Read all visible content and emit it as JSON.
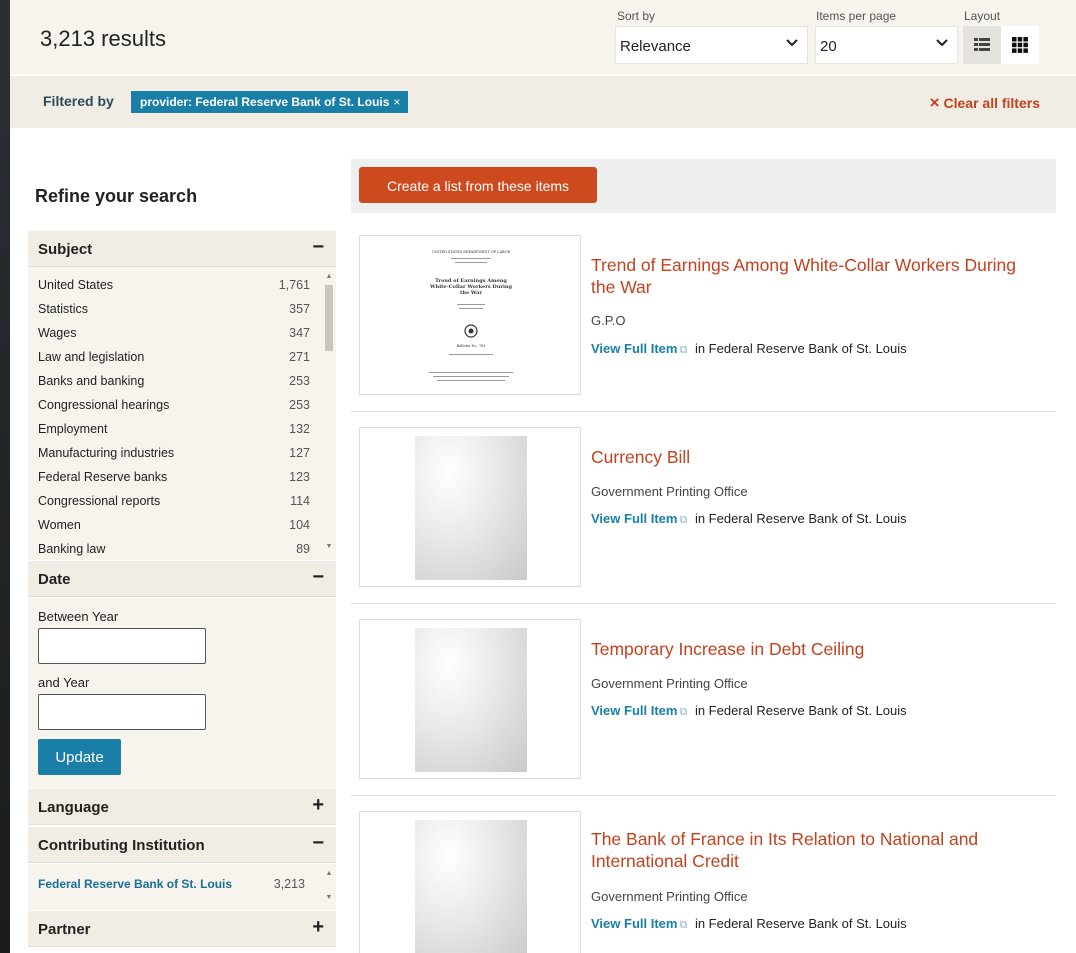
{
  "header": {
    "results_count": "3,213 results",
    "sort_label": "Sort by",
    "sort_value": "Relevance",
    "items_per_page_label": "Items per page",
    "items_per_page_value": "20",
    "layout_label": "Layout"
  },
  "filters": {
    "label": "Filtered by",
    "chips": [
      {
        "text": "provider: Federal Reserve Bank of St. Louis",
        "remove": "×"
      }
    ],
    "clear_all": "Clear all filters",
    "clear_icon": "×"
  },
  "sidebar": {
    "title": "Refine your search",
    "subject": {
      "title": "Subject",
      "toggle": "−",
      "items": [
        {
          "label": "United States",
          "count": "1,761"
        },
        {
          "label": "Statistics",
          "count": "357"
        },
        {
          "label": "Wages",
          "count": "347"
        },
        {
          "label": "Law and legislation",
          "count": "271"
        },
        {
          "label": "Banks and banking",
          "count": "253"
        },
        {
          "label": "Congressional hearings",
          "count": "253"
        },
        {
          "label": "Employment",
          "count": "132"
        },
        {
          "label": "Manufacturing industries",
          "count": "127"
        },
        {
          "label": "Federal Reserve banks",
          "count": "123"
        },
        {
          "label": "Congressional reports",
          "count": "114"
        },
        {
          "label": "Women",
          "count": "104"
        },
        {
          "label": "Banking law",
          "count": "89"
        }
      ]
    },
    "date": {
      "title": "Date",
      "toggle": "−",
      "between_label": "Between Year",
      "and_label": "and Year",
      "between_value": "",
      "and_value": "",
      "update_label": "Update"
    },
    "language": {
      "title": "Language",
      "toggle": "+"
    },
    "institution": {
      "title": "Contributing Institution",
      "toggle": "−",
      "items": [
        {
          "label": "Federal Reserve Bank of St. Louis",
          "count": "3,213"
        }
      ]
    },
    "partner": {
      "title": "Partner",
      "toggle": "+"
    }
  },
  "main": {
    "create_list_label": "Create a list from these items",
    "items": [
      {
        "title": "Trend of Earnings Among White-Collar Workers During the War",
        "publisher": "G.P.O",
        "view_label": "View Full Item",
        "in_text": "in Federal Reserve Bank of St. Louis",
        "thumb_doc": {
          "header_line": "UNITED STATES DEPARTMENT OF LABOR",
          "title_lines": [
            "Trend of Earnings Among",
            "White-Collar Workers During",
            "the War"
          ],
          "bulletin": "Bulletin No. 783"
        }
      },
      {
        "title": "Currency Bill",
        "publisher": "Government Printing Office",
        "view_label": "View Full Item",
        "in_text": "in Federal Reserve Bank of St. Louis"
      },
      {
        "title": "Temporary Increase in Debt Ceiling",
        "publisher": "Government Printing Office",
        "view_label": "View Full Item",
        "in_text": "in Federal Reserve Bank of St. Louis"
      },
      {
        "title": "The Bank of France in Its Relation to National and International Credit",
        "publisher": "Government Printing Office",
        "view_label": "View Full Item",
        "in_text": "in Federal Reserve Bank of St. Louis"
      }
    ]
  },
  "colors": {
    "accent_teal": "#1a7fa6",
    "accent_orange": "#cc4a1e",
    "title_red": "#c5411e"
  }
}
